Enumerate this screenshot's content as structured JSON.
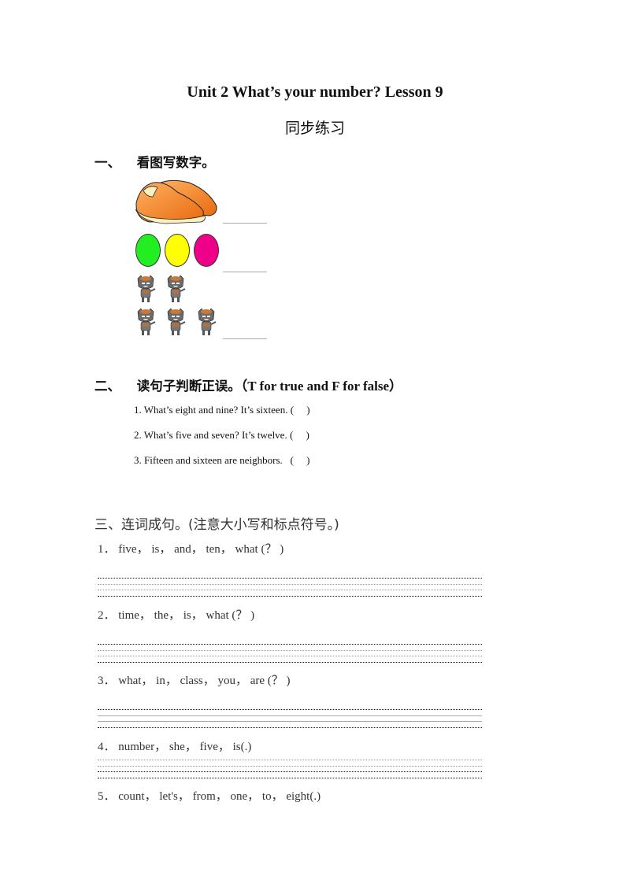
{
  "header": {
    "title": "Unit 2 What’s your number? Lesson 9",
    "subtitle": "同步练习"
  },
  "section1": {
    "number": "一、",
    "heading": "看图写数字。",
    "items": [
      {
        "image": "shoes-pair",
        "count_shown": 2,
        "answer": ""
      },
      {
        "image": "balls",
        "colors": [
          "#22ee22",
          "#ffff00",
          "#ee0088"
        ],
        "count_shown": 3,
        "answer": ""
      },
      {
        "image": "wolf-figures",
        "count_shown": 5,
        "answer": ""
      }
    ]
  },
  "section2": {
    "number": "二、",
    "heading": "读句子判断正误。",
    "heading_en": "（T for true and F for false）",
    "items": [
      "1. What’s eight and nine? It’s sixteen. (     )",
      "2. What’s five and seven? It’s twelve. (     )",
      "3. Fifteen and sixteen are neighbors.   (     )"
    ]
  },
  "section3": {
    "heading": "三、连词成句。(注意大小写和标点符号。)",
    "items": [
      "1． five， is， and， ten， what (？ )",
      "2． time， the， is， what (？ )",
      "3． what， in， class， you， are (？ )",
      "4． number， she， five， is(.)",
      "5． count， let's， from， one， to， eight(.)"
    ]
  }
}
